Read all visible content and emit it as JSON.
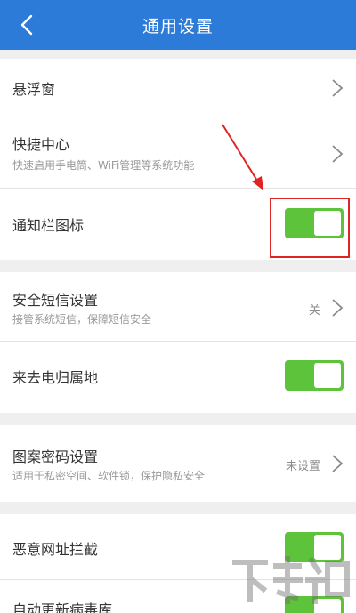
{
  "header": {
    "title": "通用设置",
    "back_icon": "chevron-left-icon"
  },
  "group1": {
    "floating_window": {
      "label": "悬浮窗"
    },
    "quick_center": {
      "label": "快捷中心",
      "sub": "快速启用手电筒、WiFi管理等系统功能"
    },
    "notify_icon": {
      "label": "通知栏图标",
      "enabled": true
    }
  },
  "group2": {
    "secure_sms": {
      "label": "安全短信设置",
      "sub": "接管系统短信，保障短信安全",
      "value": "关"
    },
    "caller_location": {
      "label": "来去电归属地",
      "enabled": true
    }
  },
  "group3": {
    "pattern_lock": {
      "label": "图案密码设置",
      "sub": "适用于私密空间、软件锁，保护隐私安全",
      "value": "未设置"
    }
  },
  "group4": {
    "malicious_url": {
      "label": "恶意网址拦截",
      "enabled": true
    },
    "auto_update": {
      "label": "自动更新病毒库",
      "enabled": true
    }
  },
  "colors": {
    "header": "#2d7bd8",
    "toggle_on": "#5cc33a",
    "annotation": "#e02424"
  }
}
